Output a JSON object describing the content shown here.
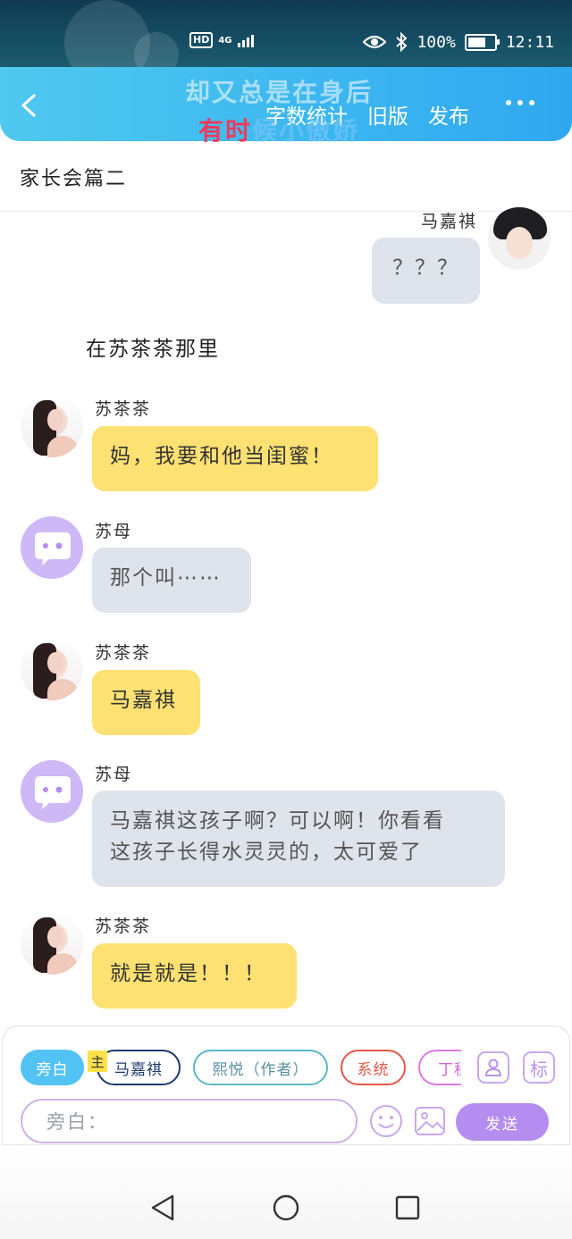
{
  "status_bar": {
    "hd": "HD",
    "network": "4G",
    "battery": "100%",
    "time": "12:11"
  },
  "nav": {
    "overlay_line1": "却又总是在身后",
    "overlay_line2_red": "有时",
    "overlay_line2_blue": "候小傲娇",
    "word_count": "字数统计",
    "old_version": "旧版",
    "publish": "发布"
  },
  "chapter_title": "家长会篇二",
  "messages": {
    "m1": {
      "speaker": "马嘉祺",
      "text": "？？？"
    },
    "narration": "在苏茶茶那里",
    "m2": {
      "speaker": "苏茶茶",
      "text": "妈，我要和他当闺蜜！"
    },
    "m3": {
      "speaker": "苏母",
      "text": "那个叫⋯⋯"
    },
    "m4": {
      "speaker": "苏茶茶",
      "text": "马嘉祺"
    },
    "m5": {
      "speaker": "苏母",
      "line1": "马嘉祺这孩子啊？可以啊！你看看",
      "line2": "这孩子长得水灵灵的，太可爱了"
    },
    "m6": {
      "speaker": "苏茶茶",
      "text": "就是就是！！！"
    }
  },
  "composer": {
    "roles": {
      "narration": "旁白",
      "main_tag": "主",
      "main": "马嘉祺",
      "author": "熙悦（作者）",
      "system": "系统",
      "ding": "丁程"
    },
    "tag_button": "标",
    "input_placeholder": "旁白：",
    "send": "发送"
  },
  "colors": {
    "accent": "#2fa8f0",
    "yellow_bubble": "#fde173",
    "gray_bubble": "#dfe3ec",
    "purple": "#b58cf0"
  }
}
